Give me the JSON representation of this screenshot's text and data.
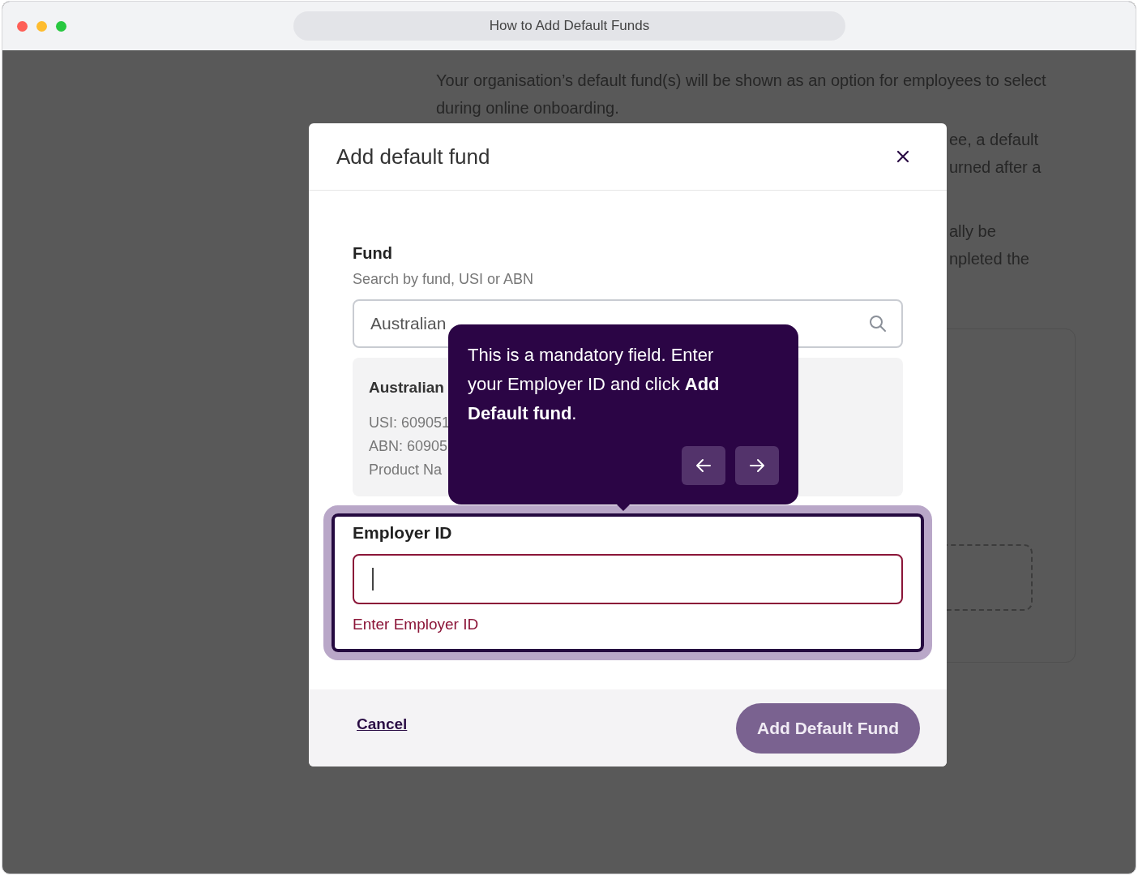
{
  "window": {
    "title": "How to Add Default Funds"
  },
  "background_page": {
    "paragraph": "Your organisation’s default fund(s) will be shown as an option for employees to select during online onboarding.",
    "fragments": [
      "ee, a default",
      "urned after a",
      "ally be",
      "npleted the"
    ]
  },
  "dialog": {
    "title": "Add default fund",
    "fund": {
      "label": "Fund",
      "hint": "Search by fund, USI or ABN",
      "value": "Australian",
      "result": {
        "name": "Australian",
        "lines": [
          "USI: 609051",
          "ABN: 60905",
          "Product Na"
        ]
      }
    },
    "employer_id": {
      "label": "Employer ID",
      "error": "Enter Employer ID",
      "highlighted": true
    },
    "cancel": "Cancel",
    "submit": {
      "label": "Add Default Fund",
      "disabled": true
    }
  },
  "tooltip": {
    "text": "This is a mandatory field. Enter your Employer ID and click **Add Default fund**."
  }
}
